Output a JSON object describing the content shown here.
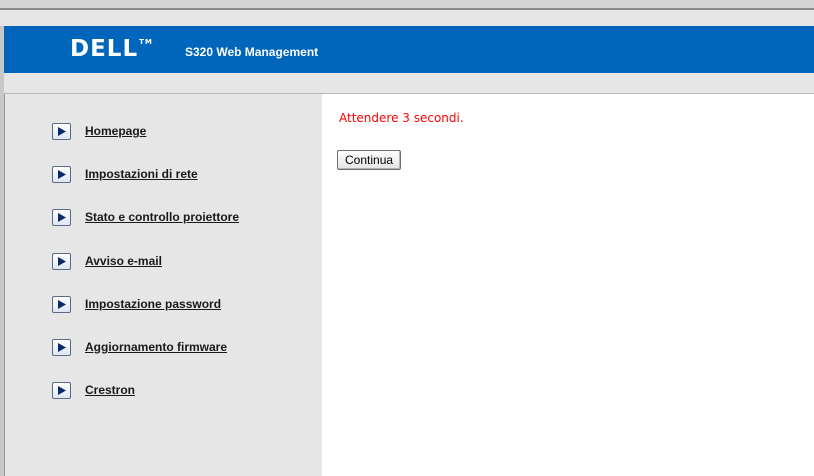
{
  "header": {
    "logo_text": "DELL",
    "logo_tm": "TM",
    "app_title": "S320 Web Management"
  },
  "sidebar": {
    "items": [
      {
        "label": "Homepage"
      },
      {
        "label": "Impostazioni di rete"
      },
      {
        "label": "Stato e controllo proiettore"
      },
      {
        "label": "Avviso e-mail"
      },
      {
        "label": "Impostazione password"
      },
      {
        "label": "Aggiornamento firmware"
      },
      {
        "label": "Crestron"
      }
    ]
  },
  "main": {
    "message": "Attendere 3 secondi.",
    "continue_label": "Continua"
  },
  "colors": {
    "brand_blue": "#0066bb",
    "message_red": "#ff0000"
  },
  "icons": {
    "nav": "play-arrow-icon"
  }
}
